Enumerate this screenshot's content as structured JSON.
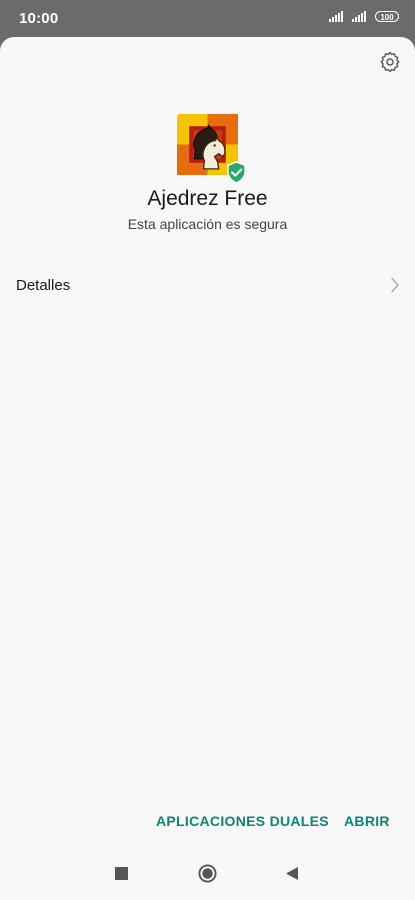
{
  "status_bar": {
    "time": "10:00",
    "battery": "100"
  },
  "app": {
    "name": "Ajedrez Free",
    "security_status": "Esta aplicación es segura",
    "icon": "chess-knight-icon",
    "badge_icon": "shield-check-icon"
  },
  "details": {
    "label": "Detalles"
  },
  "actions": {
    "dual_apps_label": "APLICACIONES DUALES",
    "open_label": "ABRIR"
  },
  "colors": {
    "accent": "#0b8577",
    "badge": "#2ea86a",
    "status_bar": "#6b6b6e",
    "background": "#f8f8f8"
  },
  "nav": {
    "recent_icon": "square-icon",
    "home_icon": "circle-icon",
    "back_icon": "triangle-back-icon"
  }
}
